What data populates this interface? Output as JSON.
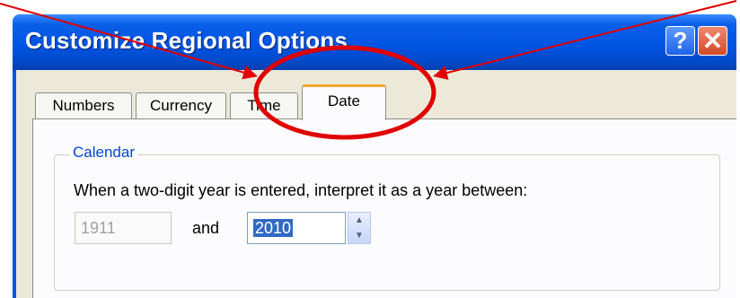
{
  "dialog": {
    "title": "Customize Regional Options",
    "help_icon": "?",
    "close_icon": "✕"
  },
  "tabs": [
    {
      "label": "Numbers",
      "selected": false
    },
    {
      "label": "Currency",
      "selected": false
    },
    {
      "label": "Time",
      "selected": false
    },
    {
      "label": "Date",
      "selected": true
    }
  ],
  "calendar": {
    "group_label": "Calendar",
    "instruction": "When a two-digit year is entered, interpret it as a year between:",
    "min_year": "1911",
    "and_label": "and",
    "max_year": "2010"
  },
  "annotation": {
    "color": "#e00000",
    "shapes": [
      "red-ellipse-highlight",
      "red-arrow-left",
      "red-arrow-right"
    ]
  }
}
